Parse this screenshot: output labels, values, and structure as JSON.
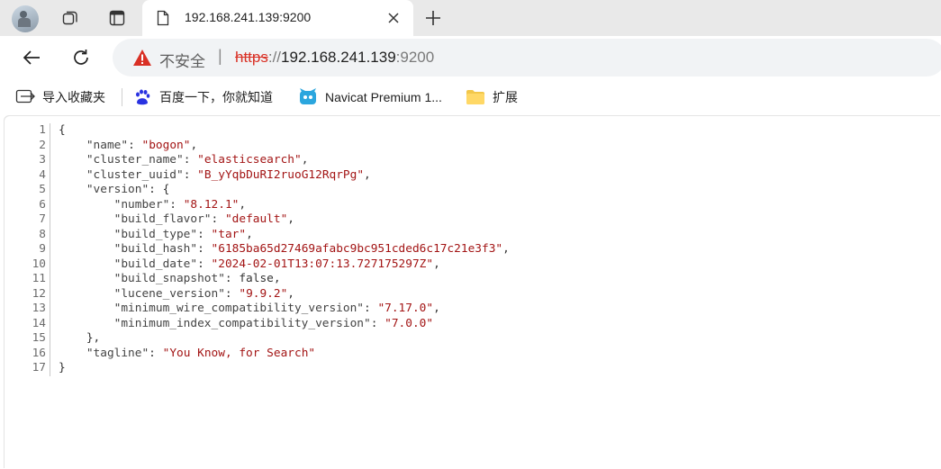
{
  "tab": {
    "title": "192.168.241.139:9200",
    "close": "×",
    "new_tab": "+"
  },
  "address": {
    "security_label": "不安全",
    "separator": "|",
    "scheme": "https",
    "scheme_sep": "://",
    "host": "192.168.241.139",
    "port": ":9200"
  },
  "bookmarks": [
    {
      "label": "导入收藏夹",
      "icon": "import-favorites-icon"
    },
    {
      "label": "百度一下，你就知道",
      "icon": "baidu-paw-icon"
    },
    {
      "label": "Navicat Premium 1...",
      "icon": "navicat-icon"
    },
    {
      "label": "扩展",
      "icon": "folder-icon"
    }
  ],
  "colors": {
    "string": "#a31515",
    "warning": "#d93025",
    "tab_strip": "#e9e9e9"
  },
  "json_lines": [
    {
      "n": "1",
      "text": "{"
    },
    {
      "n": "2",
      "text": "    \"name\": \"bogon\","
    },
    {
      "n": "3",
      "text": "    \"cluster_name\": \"elasticsearch\","
    },
    {
      "n": "4",
      "text": "    \"cluster_uuid\": \"B_yYqbDuRI2ruoG12RqrPg\","
    },
    {
      "n": "5",
      "text": "    \"version\": {"
    },
    {
      "n": "6",
      "text": "        \"number\": \"8.12.1\","
    },
    {
      "n": "7",
      "text": "        \"build_flavor\": \"default\","
    },
    {
      "n": "8",
      "text": "        \"build_type\": \"tar\","
    },
    {
      "n": "9",
      "text": "        \"build_hash\": \"6185ba65d27469afabc9bc951cded6c17c21e3f3\","
    },
    {
      "n": "10",
      "text": "        \"build_date\": \"2024-02-01T13:07:13.727175297Z\","
    },
    {
      "n": "11",
      "text": "        \"build_snapshot\": false,"
    },
    {
      "n": "12",
      "text": "        \"lucene_version\": \"9.9.2\","
    },
    {
      "n": "13",
      "text": "        \"minimum_wire_compatibility_version\": \"7.17.0\","
    },
    {
      "n": "14",
      "text": "        \"minimum_index_compatibility_version\": \"7.0.0\""
    },
    {
      "n": "15",
      "text": "    },"
    },
    {
      "n": "16",
      "text": "    \"tagline\": \"You Know, for Search\""
    },
    {
      "n": "17",
      "text": "}"
    }
  ]
}
